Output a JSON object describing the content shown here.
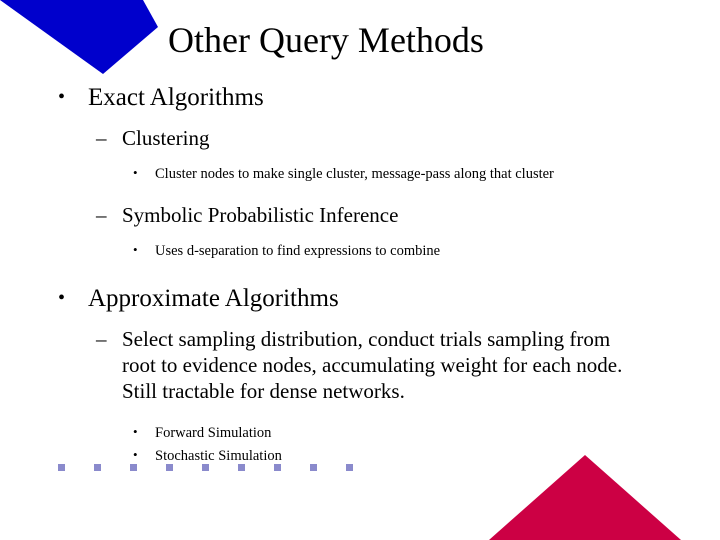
{
  "slide": {
    "title": "Other Query Methods",
    "bullet_glyph_level1": "•",
    "bullet_glyph_level2": "–",
    "bullet_glyph_level3": "•",
    "outline": [
      {
        "level": 1,
        "text": "Exact Algorithms"
      },
      {
        "level": 2,
        "text": "Clustering"
      },
      {
        "level": 3,
        "text": "Cluster nodes to make single cluster, message-pass along that cluster"
      },
      {
        "level": 2,
        "text": "Symbolic Probabilistic Inference"
      },
      {
        "level": 3,
        "text": "Uses d-separation to find expressions to combine"
      },
      {
        "level": 1,
        "text": "Approximate Algorithms"
      },
      {
        "level": 2,
        "text": "Select sampling distribution, conduct trials sampling from root to evidence nodes, accumulating weight for each node.  Still tractable for dense networks."
      },
      {
        "level": 3,
        "text": "Forward Simulation"
      },
      {
        "level": 3,
        "text": "Stochastic Simulation"
      }
    ]
  },
  "decorations": {
    "corner_banner_color": "#0000CC",
    "footer_triangle_color": "#CC0044",
    "dot_row_color": "#8A8ACC",
    "dot_count": 9,
    "background_color": "#FFFFFF"
  }
}
